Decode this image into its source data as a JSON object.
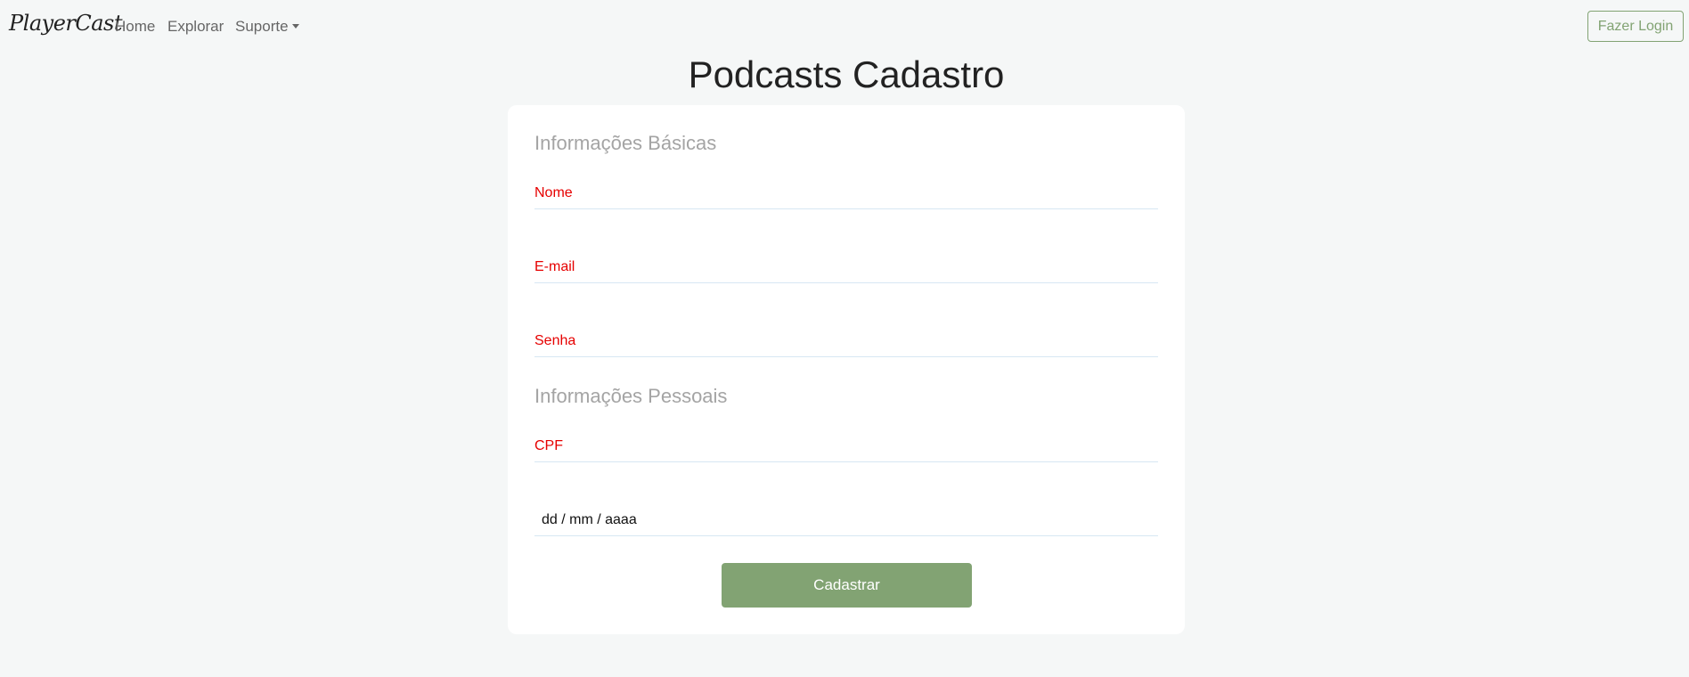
{
  "navbar": {
    "brand": "PlayerCast",
    "links": [
      "Home",
      "Explorar",
      "Suporte"
    ],
    "login_label": "Fazer Login"
  },
  "page": {
    "title": "Podcasts Cadastro"
  },
  "form": {
    "basic_section_title": "Informações Básicas",
    "personal_section_title": "Informações Pessoais",
    "fields": {
      "nome": "Nome",
      "email": "E-mail",
      "senha": "Senha",
      "cpf": "CPF",
      "date_placeholder": "dd / mm / aaaa"
    },
    "submit_label": "Cadastrar"
  },
  "colors": {
    "accent": "#82a373",
    "label": "#e60000",
    "section": "#a4a4a4",
    "background": "#f5f7f7"
  }
}
